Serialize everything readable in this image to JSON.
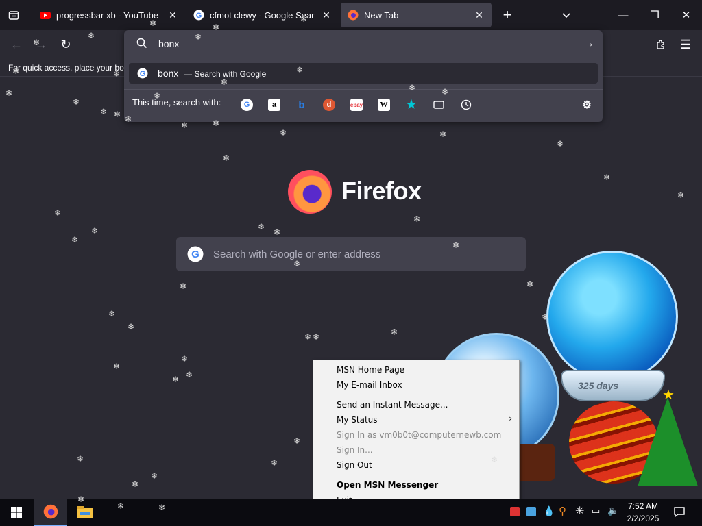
{
  "tabs": [
    {
      "title": "progressbar xb - YouTube",
      "favicon": "youtube-icon",
      "active": false
    },
    {
      "title": "cfmot clewy - Google Search",
      "favicon": "google-icon",
      "active": false
    },
    {
      "title": "New Tab",
      "favicon": "firefox-icon",
      "active": true
    }
  ],
  "bookmarks_bar": {
    "text": "For quick access, place your bookmarks here on the bookmarks toolbar."
  },
  "urlbar": {
    "value": "bonx",
    "suggestion": {
      "query": "bonx",
      "action": "Search with Google"
    },
    "one_off_label": "This time, search with:",
    "engines": [
      "Google",
      "Amazon",
      "Bing",
      "DuckDuckGo",
      "eBay",
      "Wikipedia",
      "Bookmarks",
      "Tabs",
      "History"
    ]
  },
  "ntp": {
    "brand": "Firefox",
    "search_placeholder": "Search with Google or enter address"
  },
  "decoration": {
    "globe_label": "325 days"
  },
  "context_menu": {
    "items": [
      {
        "label": "MSN Home Page",
        "disabled": false
      },
      {
        "label": "My E-mail Inbox",
        "disabled": false
      },
      {
        "label": "Send an Instant Message...",
        "disabled": false
      },
      {
        "label": "My Status",
        "disabled": false,
        "submenu": true
      },
      {
        "label": "Sign In as vm0b0t@computernewb.com",
        "disabled": true
      },
      {
        "label": "Sign In...",
        "disabled": true
      },
      {
        "label": "Sign Out",
        "disabled": false
      },
      {
        "label": "Open MSN Messenger",
        "disabled": false,
        "bold": true
      },
      {
        "label": "Exit",
        "disabled": false
      }
    ]
  },
  "taskbar": {
    "time": "7:52 AM",
    "date": "2/2/2025"
  },
  "colors": {
    "tabstrip": "#1c1b22",
    "toolbar": "#2b2a33",
    "panel": "#42414d",
    "taskbar": "#0b0b10"
  }
}
